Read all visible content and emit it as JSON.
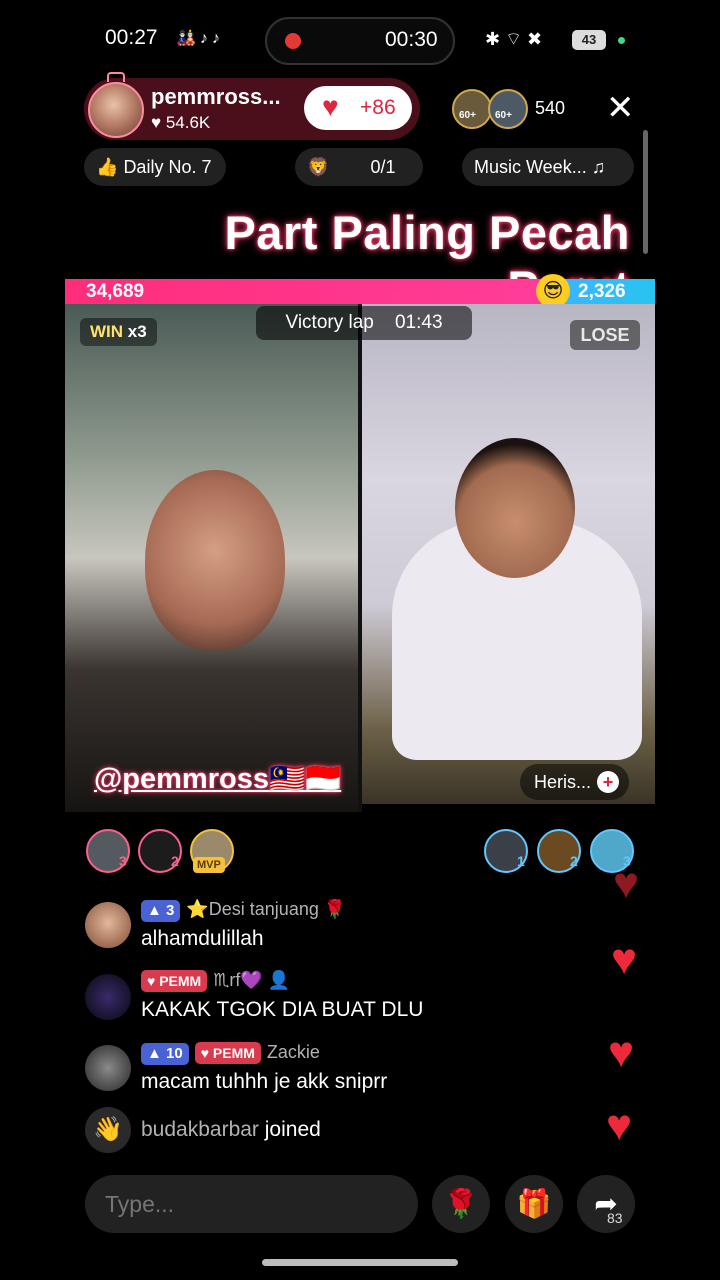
{
  "status": {
    "time": "00:27",
    "app_icons": "🎎♪♪",
    "recording_time": "00:30",
    "right_icons": "✱ ⌔ ✖",
    "battery": "43"
  },
  "host": {
    "name": "pemmross...",
    "likes": "54.6K",
    "follow_count": "+86"
  },
  "viewers": {
    "badge1": "60+",
    "badge2": "60+",
    "count": "540"
  },
  "pills": {
    "daily": "Daily No. 7",
    "progress": "0/1",
    "music": "Music Week..."
  },
  "title": "Part Paling Pecah Perut",
  "battle": {
    "left_score": "34,689",
    "right_score": "2,326",
    "win_label": "WIN",
    "win_count": "x3",
    "victory_label": "Victory lap",
    "victory_time": "01:43",
    "lose_label": "LOSE",
    "left_handle": "@pemmross🇲🇾🇮🇩",
    "right_handle": "Heris..."
  },
  "supporters": {
    "left": [
      {
        "rank": "3"
      },
      {
        "rank": "2"
      },
      {
        "rank": "MVP"
      }
    ],
    "right": [
      {
        "rank": "1"
      },
      {
        "rank": "2"
      },
      {
        "rank": "3"
      }
    ]
  },
  "chat": [
    {
      "level": "3",
      "fan": "",
      "name": "⭐Desi tanjuang 🌹",
      "text": "alhamdulillah"
    },
    {
      "level": "",
      "fan": "PEMM",
      "name": "♏rf💜",
      "text": "KAKAK TGOK DIA BUAT DLU"
    },
    {
      "level": "10",
      "fan": "PEMM",
      "name": "Zackie",
      "text": "macam tuhhh je akk sniprr"
    },
    {
      "level": "",
      "fan": "",
      "name": "budakbarbar",
      "text": "joined"
    }
  ],
  "input": {
    "placeholder": "Type..."
  },
  "share_count": "83",
  "colors": {
    "left_team": "#ff2d7a",
    "right_team": "#3bb4ff",
    "heart": "#ee2a3a"
  }
}
